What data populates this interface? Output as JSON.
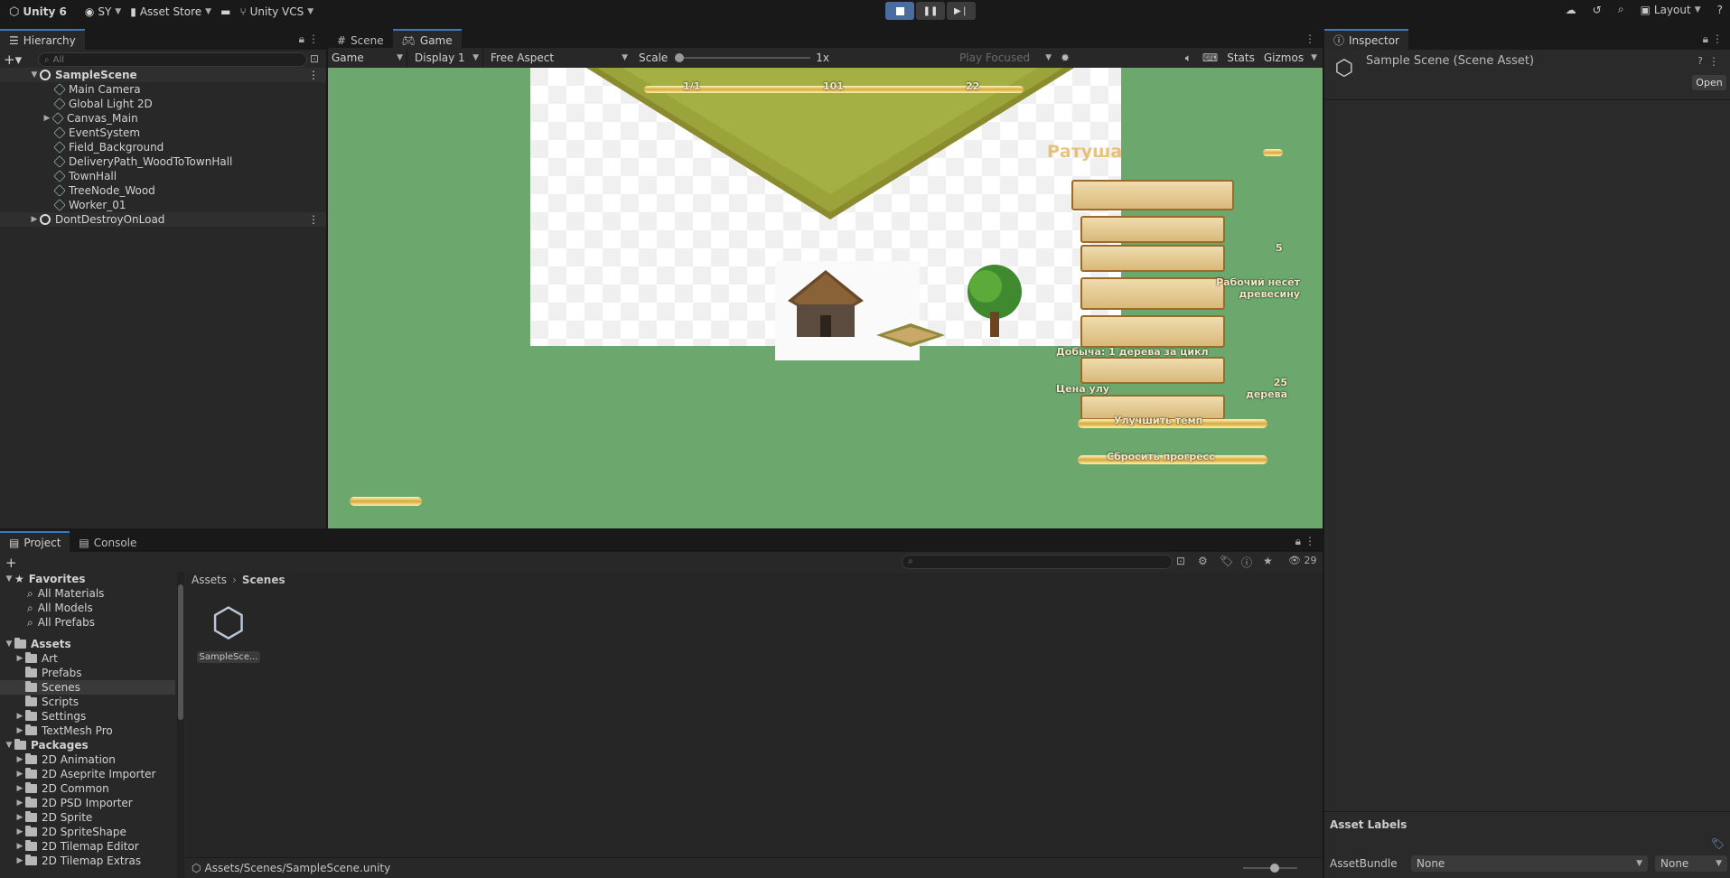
{
  "toolbar": {
    "app_title": "Unity 6",
    "account": "SY",
    "asset_store": "Asset Store",
    "vcs": "Unity VCS",
    "layout": "Layout"
  },
  "hierarchy": {
    "tab": "Hierarchy",
    "search_placeholder": "All",
    "scene": "SampleScene",
    "items": [
      "Main Camera",
      "Global Light 2D",
      "Canvas_Main",
      "EventSystem",
      "Field_Background",
      "DeliveryPath_WoodToTownHall",
      "TownHall",
      "TreeNode_Wood",
      "Worker_01"
    ],
    "dont_destroy": "DontDestroyOnLoad"
  },
  "scene_tabs": {
    "scene": "Scene",
    "game": "Game"
  },
  "gamebar": {
    "mode": "Game",
    "display": "Display 1",
    "aspect": "Free Aspect",
    "scale_label": "Scale",
    "scale_value": "1x",
    "play_focused": "Play Focused",
    "stats": "Stats",
    "gizmos": "Gizmos"
  },
  "game_ui": {
    "title": "Ратуша",
    "level_value": "5",
    "worker_status": "Рабочий несёт древесину",
    "production": "Добыча: 1 дерева за цикл",
    "upgrade_price_label": "Цена улу",
    "upgrade_price_value": "25 дерева",
    "upgrade_button": "Улучшить темп",
    "reset_button": "Сбросить прогресс",
    "top_bar_values": [
      "1/1",
      "101",
      "22"
    ]
  },
  "inspector": {
    "tab": "Inspector",
    "title": "Sample Scene (Scene Asset)",
    "open": "Open",
    "asset_labels": "Asset Labels",
    "assetbundle_label": "AssetBundle",
    "assetbundle_value": "None",
    "variant_value": "None"
  },
  "bottom_tabs": {
    "project": "Project",
    "console": "Console"
  },
  "project": {
    "count": "29",
    "breadcrumb": [
      "Assets",
      "Scenes"
    ],
    "favorites": "Favorites",
    "fav_items": [
      "All Materials",
      "All Models",
      "All Prefabs"
    ],
    "assets": "Assets",
    "asset_folders": [
      "Art",
      "Prefabs",
      "Scenes",
      "Scripts",
      "Settings",
      "TextMesh Pro"
    ],
    "packages": "Packages",
    "package_folders": [
      "2D Animation",
      "2D Aseprite Importer",
      "2D Common",
      "2D PSD Importer",
      "2D Sprite",
      "2D SpriteShape",
      "2D Tilemap Editor",
      "2D Tilemap Extras"
    ],
    "file_name": "SampleSce...",
    "path": "Assets/Scenes/SampleScene.unity"
  }
}
